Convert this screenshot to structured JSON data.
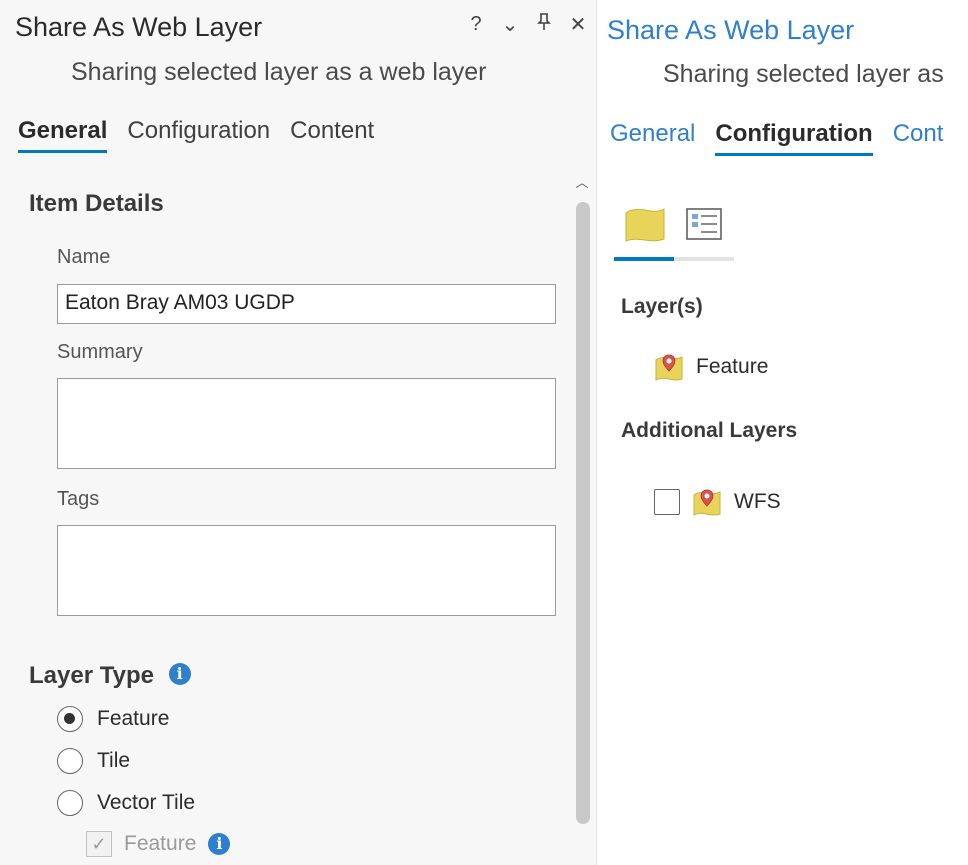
{
  "left": {
    "title": "Share As Web Layer",
    "controls": {
      "help": "?",
      "collapse": "⌄",
      "pin": "⊥",
      "close": "✕"
    },
    "subtitle": "Sharing selected layer as a web layer",
    "tabs": [
      {
        "label": "General",
        "active": true
      },
      {
        "label": "Configuration",
        "active": false
      },
      {
        "label": "Content",
        "active": false
      }
    ],
    "item_details": {
      "heading": "Item Details",
      "name_label": "Name",
      "name_value": "Eaton Bray AM03 UGDP",
      "summary_label": "Summary",
      "tags_label": "Tags"
    },
    "layer_type": {
      "heading": "Layer Type",
      "options": [
        {
          "label": "Feature",
          "checked": true
        },
        {
          "label": "Tile",
          "checked": false
        },
        {
          "label": "Vector Tile",
          "checked": false
        }
      ],
      "sub_option": {
        "label": "Feature",
        "checked": true,
        "disabled": true
      }
    }
  },
  "right": {
    "title": "Share As Web Layer",
    "subtitle": "Sharing selected layer as",
    "tabs": [
      {
        "label": "General",
        "active": false
      },
      {
        "label": "Configuration",
        "active": true
      },
      {
        "label": "Cont",
        "active": false
      }
    ],
    "layers_heading": "Layer(s)",
    "layers": [
      {
        "label": "Feature"
      }
    ],
    "additional_heading": "Additional Layers",
    "additional_layers": [
      {
        "label": "WFS",
        "checked": false
      }
    ]
  },
  "colors": {
    "accent": "#0079c1",
    "link_blue": "#2f7fcf",
    "layer_yellow": "#e8d45a",
    "marker_red": "#d9534f"
  }
}
